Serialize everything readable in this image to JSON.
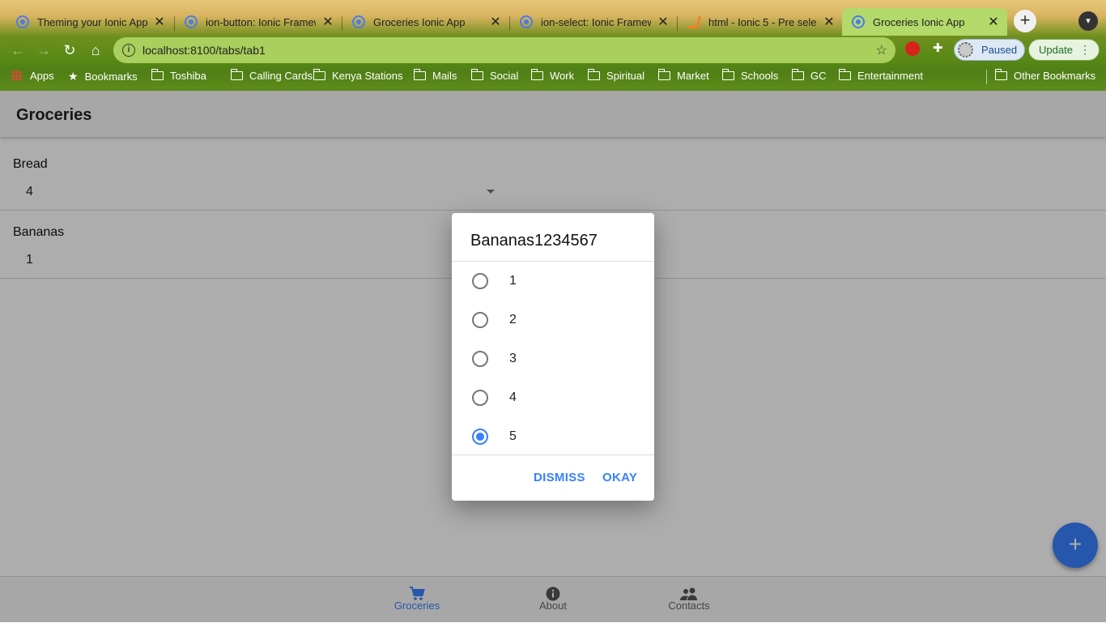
{
  "browser": {
    "tabs": [
      {
        "title": "Theming your Ionic App",
        "icon": "ionic-favicon"
      },
      {
        "title": "ion-button: Ionic Framew",
        "icon": "ionic-favicon"
      },
      {
        "title": "Groceries Ionic App",
        "icon": "ionic-favicon"
      },
      {
        "title": "ion-select: Ionic Framew",
        "icon": "ionic-favicon"
      },
      {
        "title": "html - Ionic 5 - Pre selec",
        "icon": "stackoverflow-favicon"
      },
      {
        "title": "Groceries Ionic App",
        "icon": "ionic-favicon",
        "active": true
      }
    ],
    "url": "localhost:8100/tabs/tab1",
    "profile_label": "Paused",
    "update_label": "Update",
    "bookmarks": [
      "Apps",
      "Bookmarks",
      "Toshiba",
      "Calling Cards",
      "Kenya Stations",
      "Mails",
      "Social",
      "Work",
      "Spiritual",
      "Market",
      "Schools",
      "GC",
      "Entertainment"
    ],
    "other_bookmarks": "Other Bookmarks"
  },
  "app": {
    "title": "Groceries",
    "items": [
      {
        "name": "Bread",
        "quantity": "4"
      },
      {
        "name": "Bananas",
        "quantity": "1"
      }
    ],
    "tabbar": [
      {
        "label": "Groceries",
        "icon": "cart-icon",
        "selected": true
      },
      {
        "label": "About",
        "icon": "info-icon"
      },
      {
        "label": "Contacts",
        "icon": "people-icon"
      }
    ],
    "fab_icon": "+",
    "accent_color": "#3880ff"
  },
  "dialog": {
    "title": "Bananas1234567",
    "options": [
      "1",
      "2",
      "3",
      "4",
      "5"
    ],
    "selected": "5",
    "dismiss_label": "DISMISS",
    "okay_label": "OKAY"
  }
}
